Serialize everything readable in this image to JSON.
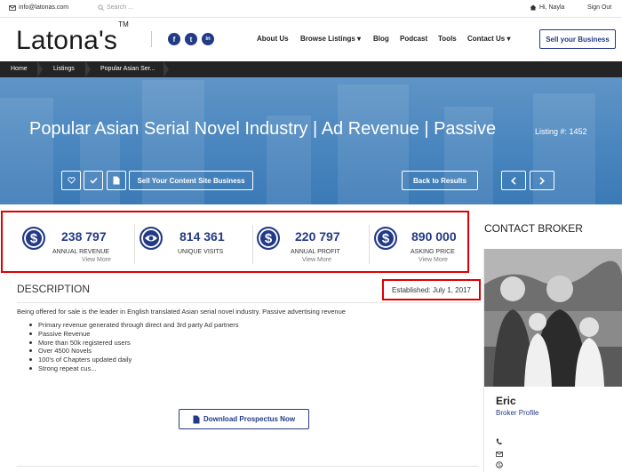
{
  "topbar": {
    "email": "info@latonas.com",
    "search_placeholder": "Search ...",
    "greeting": "Hi, Nayla",
    "signout": "Sign Out"
  },
  "header": {
    "logo": "Latona's",
    "logo_tm": "TM",
    "social": [
      "f",
      "t",
      "in"
    ],
    "nav": [
      "About Us",
      "Browse Listings",
      "Blog",
      "Podcast",
      "Tools",
      "Contact Us"
    ],
    "sell_button": "Sell your Business"
  },
  "breadcrumb": [
    "Home",
    "Listings",
    "Popular Asian Ser..."
  ],
  "hero": {
    "title": "Popular Asian Serial Novel Industry | Ad Revenue | Passive",
    "listing": "Listing #: 1452",
    "sell_content_button": "Sell Your Content Site Business",
    "back_button": "Back to Results"
  },
  "stats": [
    {
      "value": "238 797",
      "label": "ANNUAL REVENUE",
      "more": "View More",
      "icon": "dollar-icon"
    },
    {
      "value": "814 361",
      "label": "UNIQUE VISITS",
      "more": "",
      "icon": "eye-icon"
    },
    {
      "value": "220 797",
      "label": "ANNUAL PROFIT",
      "more": "View More",
      "icon": "dollar-icon"
    },
    {
      "value": "890 000",
      "label": "ASKING PRICE",
      "more": "View More",
      "icon": "dollar-icon"
    }
  ],
  "description": {
    "title": "DESCRIPTION",
    "established": "Established: July 1, 2017",
    "intro": "Being offered for sale is the leader in English translated Asian serial novel industry. Passive advertising revenue",
    "bullets": [
      "Primary revenue generated through direct and 3rd party Ad partners",
      "Passive Revenue",
      "More than 50k registered users",
      "Over 4500 Novels",
      "100's of Chapters updated daily",
      "Strong repeat cus..."
    ],
    "download_button": "Download Prospectus Now"
  },
  "broker": {
    "section_title": "CONTACT BROKER",
    "name": "Eric",
    "profile_link": "Broker Profile"
  },
  "colors": {
    "brand": "#233a87",
    "highlight": "#e00000",
    "breadcrumb_bg": "#242424",
    "hero_bg": "#4d88c0"
  }
}
